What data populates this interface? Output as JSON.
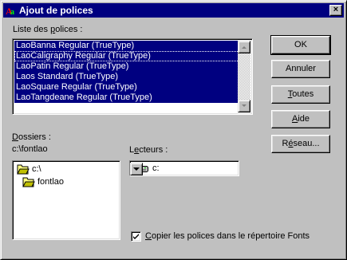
{
  "window": {
    "title": "Ajout de polices",
    "close_label": "×"
  },
  "fonts": {
    "label_pre": "Liste des ",
    "label_accel": "p",
    "label_post": "olices :",
    "items": [
      "LaoBanna Regular (TrueType)",
      "LaoCaligraphy Regular (TrueType)",
      "LaoPatin Regular (TrueType)",
      "Laos Standard (TrueType)",
      "LaoSquare Regular (TrueType)",
      "LaoTangdeane Regular (TrueType)"
    ]
  },
  "folders": {
    "label_accel": "D",
    "label_post": "ossiers :",
    "current_path": "c:\\fontlao",
    "items": [
      "c:\\",
      "fontlao"
    ]
  },
  "drives": {
    "label_pre": "L",
    "label_accel": "e",
    "label_post": "cteurs :",
    "selected": "c:"
  },
  "buttons": {
    "ok": "OK",
    "cancel": "Annuler",
    "all_accel": "T",
    "all_post": "outes",
    "help_accel": "A",
    "help_post": "ide",
    "network_pre": "R",
    "network_accel": "é",
    "network_post": "seau..."
  },
  "copy_option": {
    "label_accel": "C",
    "label_post": "opier les polices dans le répertoire Fonts",
    "checked": true
  },
  "colors": {
    "face": "#c0c0c0",
    "title_bar": "#000080",
    "selection": "#000080"
  }
}
